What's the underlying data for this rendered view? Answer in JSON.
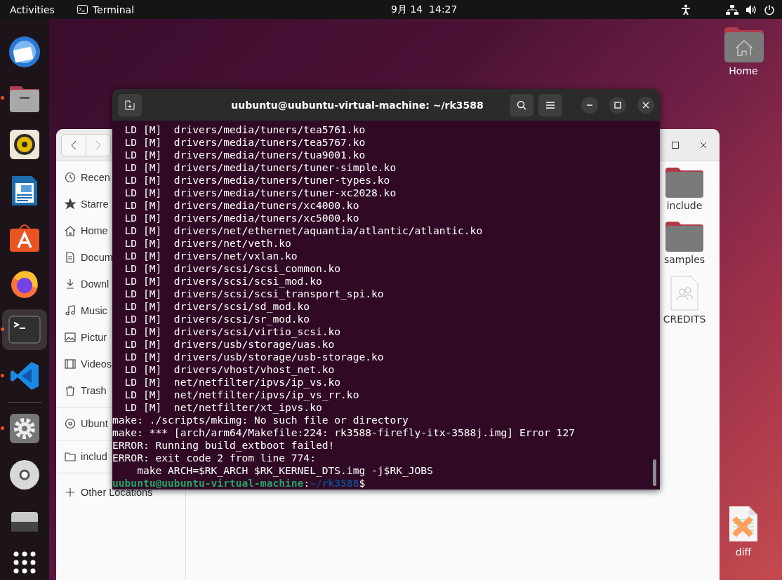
{
  "top_bar": {
    "activities": "Activities",
    "app_menu": "Terminal",
    "clock": "9月 14  14:27"
  },
  "dock": {
    "apps": [
      {
        "running": false,
        "selected": false
      },
      {
        "running": true,
        "selected": false
      },
      {
        "running": false,
        "selected": false
      },
      {
        "running": false,
        "selected": false
      },
      {
        "running": false,
        "selected": false
      },
      {
        "running": false,
        "selected": false
      },
      {
        "running": true,
        "selected": true
      },
      {
        "running": true,
        "selected": false
      },
      {
        "running": true,
        "selected": false
      },
      {
        "running": false,
        "selected": false
      },
      {
        "running": false,
        "selected": false
      }
    ]
  },
  "desktop_icons": [
    {
      "label": "Home",
      "kind": "home"
    },
    {
      "label": "diff",
      "kind": "diff"
    }
  ],
  "file_manager": {
    "sidebar": {
      "items": [
        {
          "label": "Recen",
          "kind": "recent"
        },
        {
          "label": "Starre",
          "kind": "starred"
        },
        {
          "label": "Home",
          "kind": "home"
        },
        {
          "label": "Docum",
          "kind": "documents"
        },
        {
          "label": "Downl",
          "kind": "downloads"
        },
        {
          "label": "Music",
          "kind": "music"
        },
        {
          "label": "Pictur",
          "kind": "pictures"
        },
        {
          "label": "Videos",
          "kind": "videos"
        },
        {
          "label": "Trash",
          "kind": "trash"
        },
        {
          "label": "Ubunt",
          "kind": "disc"
        },
        {
          "label": "includ",
          "kind": "folder"
        },
        {
          "label": "Other Locations",
          "kind": "other"
        }
      ]
    },
    "files": [
      {
        "label": "include",
        "kind": "folder"
      },
      {
        "label": "samples",
        "kind": "folder"
      },
      {
        "label": "CREDITS",
        "kind": "document"
      }
    ]
  },
  "terminal": {
    "title": "uubuntu@uubuntu-virtual-machine: ~/rk3588",
    "lines": [
      "  LD [M]  drivers/media/tuners/tea5761.ko",
      "  LD [M]  drivers/media/tuners/tea5767.ko",
      "  LD [M]  drivers/media/tuners/tua9001.ko",
      "  LD [M]  drivers/media/tuners/tuner-simple.ko",
      "  LD [M]  drivers/media/tuners/tuner-types.ko",
      "  LD [M]  drivers/media/tuners/tuner-xc2028.ko",
      "  LD [M]  drivers/media/tuners/xc4000.ko",
      "  LD [M]  drivers/media/tuners/xc5000.ko",
      "  LD [M]  drivers/net/ethernet/aquantia/atlantic/atlantic.ko",
      "  LD [M]  drivers/net/veth.ko",
      "  LD [M]  drivers/net/vxlan.ko",
      "  LD [M]  drivers/scsi/scsi_common.ko",
      "  LD [M]  drivers/scsi/scsi_mod.ko",
      "  LD [M]  drivers/scsi/scsi_transport_spi.ko",
      "  LD [M]  drivers/scsi/sd_mod.ko",
      "  LD [M]  drivers/scsi/sr_mod.ko",
      "  LD [M]  drivers/scsi/virtio_scsi.ko",
      "  LD [M]  drivers/usb/storage/uas.ko",
      "  LD [M]  drivers/usb/storage/usb-storage.ko",
      "  LD [M]  drivers/vhost/vhost_net.ko",
      "  LD [M]  net/netfilter/ipvs/ip_vs.ko",
      "  LD [M]  net/netfilter/ipvs/ip_vs_rr.ko",
      "  LD [M]  net/netfilter/xt_ipvs.ko",
      "make: ./scripts/mkimg: No such file or directory",
      "make: *** [arch/arm64/Makefile:224: rk3588-firefly-itx-3588j.img] Error 127",
      "ERROR: Running build_extboot failed!",
      "ERROR: exit code 2 from line 774:",
      "    make ARCH=$RK_ARCH $RK_KERNEL_DTS.img -j$RK_JOBS"
    ],
    "prompt": {
      "user_host": "uubuntu@uubuntu-virtual-machine",
      "separator": ":",
      "path": "~/rk3588",
      "symbol": "$"
    }
  }
}
